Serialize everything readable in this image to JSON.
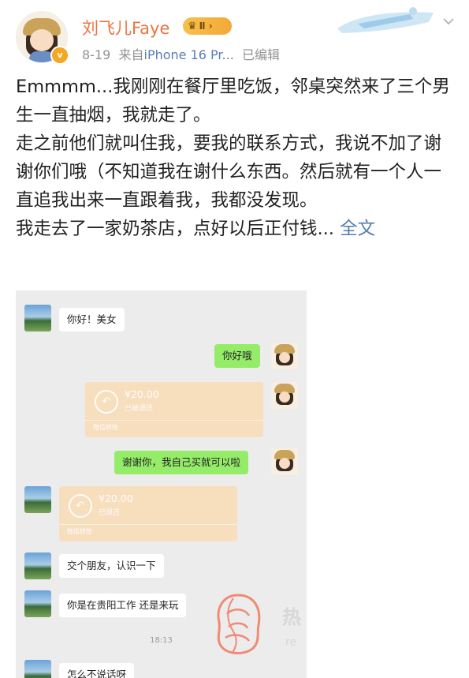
{
  "post": {
    "username": "刘飞儿Faye",
    "vip_level": "Ⅱ",
    "verified_icon": "v-verified-icon",
    "date": "8-19",
    "source_prefix": "来自",
    "device": "iPhone 16 Pr...",
    "edited": "已编辑",
    "paragraphs": [
      "Emmmm...我刚刚在餐厅里吃饭，邻桌突然来了三个男生一直抽烟，我就走了。",
      "走之前他们就叫住我，要我的联系方式，我说不加了谢谢你们哦（不知道我在谢什么东西。然后就有一个人一直追我出来一直跟着我，我都没发现。"
    ],
    "truncated_line": "我走去了一家奶茶店，点好以后正付钱...",
    "expand_label": "全文"
  },
  "chat": {
    "messages": [
      {
        "from": "other",
        "text": "你好！美女"
      },
      {
        "from": "me",
        "text": "你好哦"
      },
      {
        "from": "me",
        "type": "transfer",
        "amount": "¥20.00",
        "status": "已被退还",
        "footer": "微信转账"
      },
      {
        "from": "me",
        "text": "谢谢你，我自己买就可以啦"
      },
      {
        "from": "other",
        "type": "transfer",
        "amount": "¥20.00",
        "status": "已退还",
        "footer": "微信转账"
      },
      {
        "from": "other",
        "text": "交个朋友，认识一下"
      },
      {
        "from": "other",
        "text": "你是在贵阳工作  还是来玩"
      },
      {
        "from": "other",
        "text": "怎么不说话呀"
      }
    ],
    "timestamp": "18:13"
  },
  "watermark": {
    "text": "热",
    "sub": "re"
  },
  "colors": {
    "username": "#eb7340",
    "link": "#507daf",
    "chat_bg": "#ececec",
    "green_bubble": "#95ec69",
    "transfer": "#f9dcb5"
  }
}
